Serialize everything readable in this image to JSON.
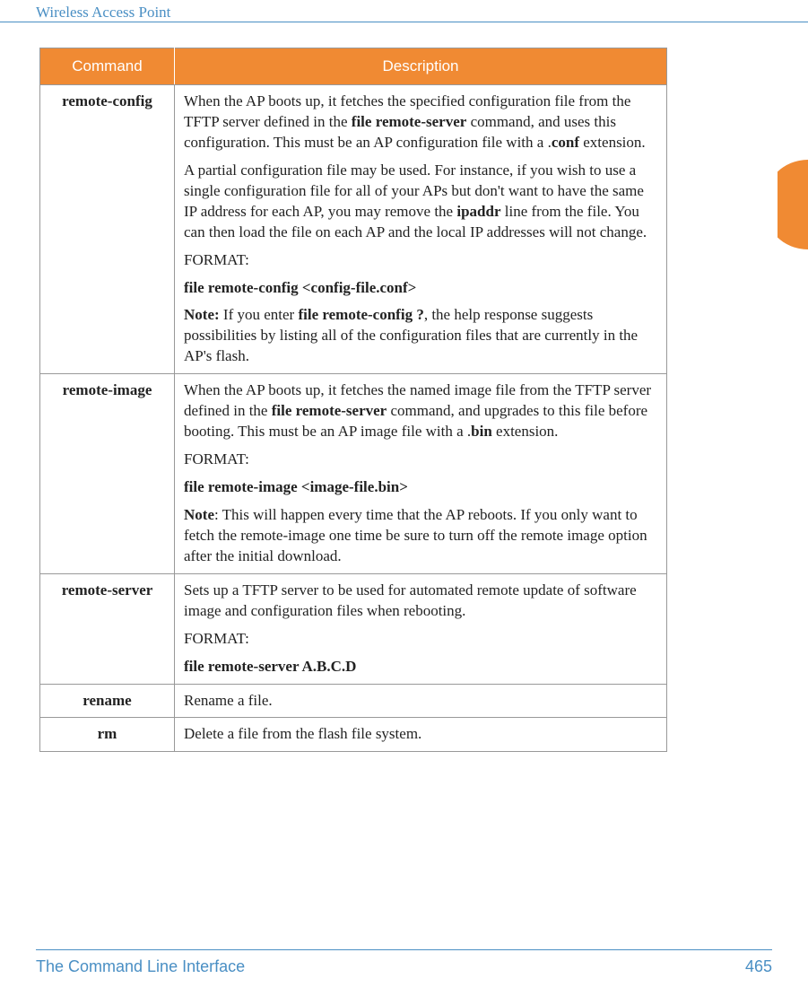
{
  "header": {
    "title": "Wireless Access Point"
  },
  "table": {
    "headers": {
      "command": "Command",
      "description": "Description"
    },
    "rows": [
      {
        "command": "remote-config",
        "desc": {
          "p1_pre": "When the AP boots up, it fetches the specified configuration file from the TFTP server defined in the ",
          "p1_b1": "file remote-server",
          "p1_mid": " command, and uses this configuration. This must be an AP configuration file with a .",
          "p1_b2": "conf",
          "p1_post": " extension.",
          "p2_pre": "A partial configuration file may be used. For instance, if you wish to use a single configuration file for all of your APs but don't want to have the same IP address for each AP, you may remove the ",
          "p2_b1": "ipaddr",
          "p2_post": " line from the file. You can then load the file on each AP and the local IP addresses will not change.",
          "p3": "FORMAT:",
          "p4_b": "file remote-config <config-file.conf>",
          "p5_b1": "Note:",
          "p5_mid1": " If you enter ",
          "p5_b2": "file remote-config ?",
          "p5_post": ", the help response suggests possibilities by listing all of the configuration files that are currently in the AP's flash."
        }
      },
      {
        "command": "remote-image",
        "desc": {
          "p1_pre": "When the AP boots up, it fetches the named image file from the TFTP server defined in the ",
          "p1_b1": "file remote-server",
          "p1_mid": " command, and upgrades to this file before booting. This must be an AP image file with a .",
          "p1_b2": "bin",
          "p1_post": " extension.",
          "p2": "FORMAT:",
          "p3_b": "file remote-image <image-file.bin>",
          "p4_b1": "Note",
          "p4_post": ": This will happen every time that the AP reboots. If you only want to fetch the remote-image one time be sure to turn off the remote image option after the initial download."
        }
      },
      {
        "command": "remote-server",
        "desc": {
          "p1": "Sets up a TFTP server to be used for automated remote update of software image and configuration files when rebooting.",
          "p2": "FORMAT:",
          "p3_b": "file remote-server A.B.C.D"
        }
      },
      {
        "command": "rename",
        "desc": {
          "p1": "Rename a file."
        }
      },
      {
        "command": "rm",
        "desc": {
          "p1": "Delete a file from the flash file system."
        }
      }
    ]
  },
  "footer": {
    "title": "The Command Line Interface",
    "page": "465"
  }
}
